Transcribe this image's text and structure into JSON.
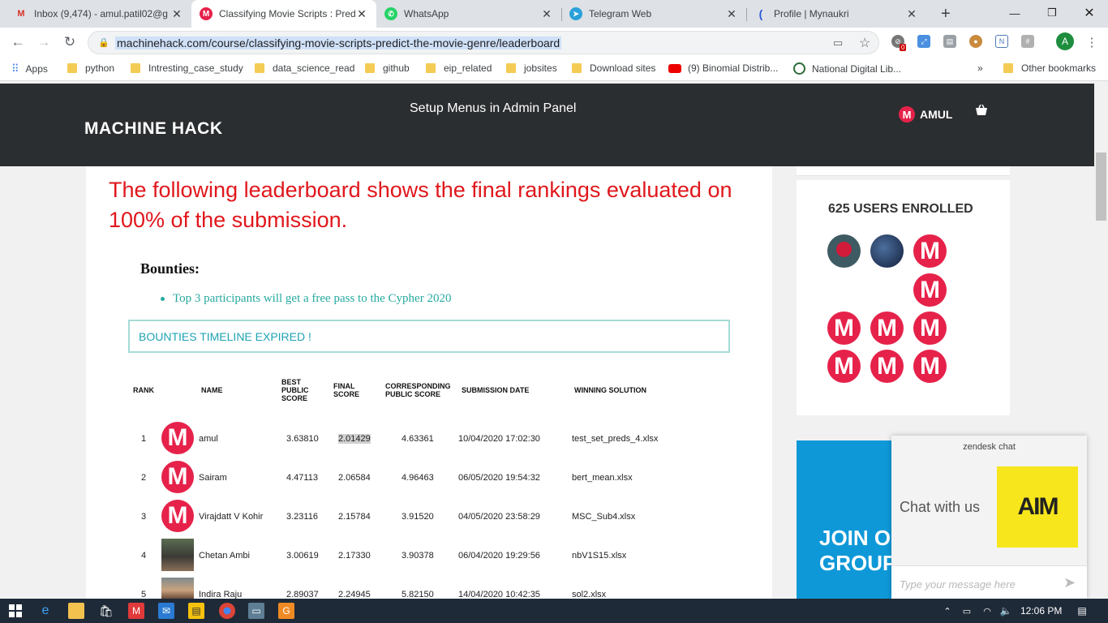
{
  "browser": {
    "tabs": [
      {
        "title": "Inbox (9,474) - amul.patil02@g",
        "icon": "gmail-icon",
        "active": false
      },
      {
        "title": "Classifying Movie Scripts : Pred",
        "icon": "machinehack-icon",
        "active": true
      },
      {
        "title": "WhatsApp",
        "icon": "whatsapp-icon",
        "active": false
      },
      {
        "title": "Telegram Web",
        "icon": "telegram-icon",
        "active": false
      },
      {
        "title": "Profile | Mynaukri",
        "icon": "naukri-icon",
        "active": false
      }
    ],
    "new_tab": "+",
    "url": "machinehack.com/course/classifying-movie-scripts-predict-the-movie-genre/leaderboard",
    "profile_initial": "A",
    "ext_badge": "0",
    "bookmarks": [
      "Apps",
      "python",
      "Intresting_case_study",
      "data_science_read",
      "github",
      "eip_related",
      "jobsites",
      "Download sites",
      "(9) Binomial Distrib...",
      "National Digital Lib...",
      "»",
      "Other bookmarks"
    ]
  },
  "site": {
    "logo": "MACHINE HACK",
    "setup_menu": "Setup Menus in Admin Panel",
    "user_name": "AMUL"
  },
  "content": {
    "headline": "The following leaderboard shows the final rankings evaluated on 100% of the submission.",
    "bounties_title": "Bounties:",
    "bounty_item": "Top 3 participants will get a free pass to the Cypher 2020",
    "expired_notice": "BOUNTIES TIMELINE EXPIRED !"
  },
  "leaderboard": {
    "headers": {
      "rank": "RANK",
      "name": "NAME",
      "best_public_score": "BEST PUBLIC SCORE",
      "final_score": "FINAL SCORE",
      "corresponding_public_score": "CORRESPONDING PUBLIC SCORE",
      "submission_date": "SUBMISSION DATE",
      "winning_solution": "WINNING SOLUTION"
    },
    "rows": [
      {
        "rank": "1",
        "name": "amul",
        "best_public": "3.63810",
        "final": "2.01429",
        "corresponding": "4.63361",
        "date": "10/04/2020 17:02:30",
        "solution": "test_set_preds_4.xlsx",
        "avatar": "machinehack-logo"
      },
      {
        "rank": "2",
        "name": "Sairam",
        "best_public": "4.47113",
        "final": "2.06584",
        "corresponding": "4.96463",
        "date": "06/05/2020 19:54:32",
        "solution": "bert_mean.xlsx",
        "avatar": "machinehack-logo"
      },
      {
        "rank": "3",
        "name": "Virajdatt V Kohir",
        "best_public": "3.23116",
        "final": "2.15784",
        "corresponding": "3.91520",
        "date": "04/05/2020 23:58:29",
        "solution": "MSC_Sub4.xlsx",
        "avatar": "machinehack-logo"
      },
      {
        "rank": "4",
        "name": "Chetan Ambi",
        "best_public": "3.00619",
        "final": "2.17330",
        "corresponding": "3.90378",
        "date": "06/04/2020 19:29:56",
        "solution": "nbV1S15.xlsx",
        "avatar": "photo"
      },
      {
        "rank": "5",
        "name": "Indira Raju",
        "best_public": "2.89037",
        "final": "2.24945",
        "corresponding": "5.82150",
        "date": "14/04/2020 10:42:35",
        "solution": "sol2.xlsx",
        "avatar": "photo"
      }
    ]
  },
  "sidebar": {
    "enrolled_title": "625 USERS ENROLLED",
    "telegram_banner": "JOIN OUR TELEGRAM GROUP"
  },
  "chat": {
    "brand": "zendesk chat",
    "title": "Chat with us",
    "logo_text": "AIM",
    "placeholder": "Type your message here"
  },
  "taskbar": {
    "time": "12:06 PM"
  },
  "colors": {
    "header_bg": "#2b2e30",
    "headline_red": "#e0171c",
    "teal": "#27aaa0",
    "brand_pink": "#e6224a",
    "telegram_blue": "#0f98d8",
    "aim_yellow": "#f7e61c"
  }
}
